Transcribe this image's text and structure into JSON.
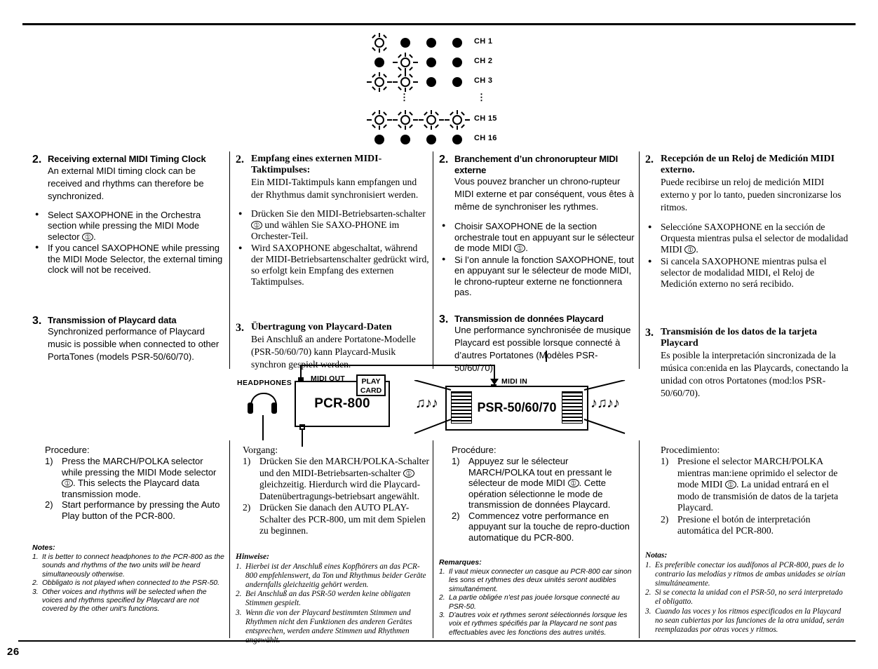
{
  "page": {
    "number": "26"
  },
  "led_matrix": {
    "rows": [
      {
        "label": "CH 1",
        "states": [
          "lit",
          "off",
          "off",
          "off"
        ]
      },
      {
        "label": "CH 2",
        "states": [
          "off",
          "lit",
          "off",
          "off"
        ]
      },
      {
        "label": "CH 3",
        "states": [
          "lit",
          "lit",
          "off",
          "off"
        ]
      },
      {
        "label": "",
        "states": [
          "gap",
          "dots",
          "gap",
          "gap"
        ],
        "is_gap": true,
        "label_dots": "⋮"
      },
      {
        "label": "CH 15",
        "states": [
          "lit",
          "lit",
          "lit",
          "lit"
        ]
      },
      {
        "label": "CH 16",
        "states": [
          "off",
          "off",
          "off",
          "off"
        ]
      }
    ]
  },
  "columns": {
    "english": {
      "section2": {
        "number": "2.",
        "heading": "Receiving external MIDI Timing Clock",
        "body": "An external MIDI timing clock can be received and rhythms can therefore be synchronized.",
        "bullets": [
          "Select SAXOPHONE in the Orchestra section while pressing the MIDI Mode selector ➀ .",
          "If you cancel SAXOPHONE while pressing the MIDI Mode Selector, the external timing clock will not be received."
        ],
        "bullet1_pre": "Select SAXOPHONE in the Orchestra section while pressing the MIDI Mode selector",
        "bullet1_post": ".",
        "bullet2": "If you cancel SAXOPHONE while pressing the MIDI Mode Selector, the external timing clock will not be received."
      },
      "section3": {
        "number": "3.",
        "heading": "Transmission of Playcard data",
        "body": "Synchronized performance of Playcard music is possible when connected to other PortaTones (models PSR-50/60/70)."
      },
      "procedure": {
        "title": "Procedure:",
        "steps": [
          {
            "n": "1)",
            "pre": "Press the MARCH/POLKA selector while pressing the MIDI Mode selector",
            "post": ". This selects the Playcard data transmission mode."
          },
          {
            "n": "2)",
            "pre": "Start performance by pressing the Auto Play button of the PCR-800.",
            "post": ""
          }
        ]
      },
      "notes": {
        "title": "Notes:",
        "items": [
          {
            "n": "1.",
            "text": "It is better to connect headphones to the PCR-800 as the sounds and rhythms of the two units will be heard simultaneously otherwise."
          },
          {
            "n": "2.",
            "text": "Obbligato is not played when connected to the PSR-50."
          },
          {
            "n": "3.",
            "text": "Other voices and rhythms will be selected when the voices and rhythms specified by Playcard are not covered by the other unit's functions."
          }
        ]
      }
    },
    "german": {
      "section2": {
        "number": "2.",
        "heading": "Empfang eines externen MIDI-Taktimpulses:",
        "body": "Ein MIDI-Taktimpuls kann empfangen und der Rhythmus damit synchronisiert werden.",
        "bullet1_pre": "Drücken Sie den MIDI-Betriebsarten-schalter",
        "bullet1_post": "und wählen Sie SAXO-PHONE im Orchester-Teil.",
        "bullet2": "Wird SAXOPHONE abgeschaltat, während der MIDI-Betriebsartenschalter gedrückt wird, so erfolgt kein Empfang des externen Taktimpulses."
      },
      "section3": {
        "number": "3.",
        "heading": "Übertragung von Playcard-Daten",
        "body": "Bei Anschluß an andere Portatone-Modelle (PSR-50/60/70) kann Playcard-Musik synchron gespielt werden."
      },
      "procedure": {
        "title": "Vorgang:",
        "steps": [
          {
            "n": "1)",
            "pre": "Drücken Sie den MARCH/POLKA-Schalter und den MIDI-Betriebsarten-schalter",
            "post": "gleichzeitig. Hierdurch wird die Playcard-Datenübertragungs-betriebsart angewählt."
          },
          {
            "n": "2)",
            "pre": "Drücken Sie danach den AUTO PLAY-Schalter des PCR-800, um mit dem Spielen zu beginnen.",
            "post": ""
          }
        ]
      },
      "notes": {
        "title": "Hinweise:",
        "items": [
          {
            "n": "1.",
            "text": "Hierbei ist der Anschluß eines Kopfhörers an das PCR-800 empfehlenswert, da Ton und Rhythmus beider Geräte andernfalls gleichzeitig gehört werden."
          },
          {
            "n": "2.",
            "text": "Bei Anschluß an das PSR-50 werden keine obligaten Stimmen gespielt."
          },
          {
            "n": "3.",
            "text": "Wenn die von der Playcard bestimmten Stimmen und Rhythmen nicht den Funktionen des anderen Gerätes entsprechen, werden andere Stimmen und Rhythmen angewählt."
          }
        ]
      }
    },
    "french": {
      "section2": {
        "number": "2.",
        "heading": "Branchement d’un chronorupteur MIDI externe",
        "body": "Vous pouvez brancher un chrono-rupteur MIDI externe et par conséquent, vous êtes à même de synchroniser les rythmes.",
        "bullet1_pre": "Choisir SAXOPHONE de la section orchestrale tout en appuyant sur le sélecteur de mode MIDI",
        "bullet1_post": ".",
        "bullet2": "Si l’on annule la fonction SAXOPHONE, tout en appuyant sur le sélecteur de mode MIDI, le chrono-rupteur externe ne fonctionnera pas."
      },
      "section3": {
        "number": "3.",
        "heading": "Transmission de données Playcard",
        "body": "Une performance synchronisée de musique Playcard est possible lorsque connecté à d’autres Portatones (Modèles PSR-50/60/70)."
      },
      "procedure": {
        "title": "Procédure:",
        "steps": [
          {
            "n": "1)",
            "pre": "Appuyez sur le sélecteur MARCH/POLKA tout en pressant le sélecteur de mode MIDI",
            "post": ". Cette opération sélectionne le mode de transmission de données Playcard."
          },
          {
            "n": "2)",
            "pre": "Commencez votre performance en appuyant sur la touche de repro-duction automatique du PCR-800.",
            "post": ""
          }
        ]
      },
      "notes": {
        "title": "Remarques:",
        "items": [
          {
            "n": "1.",
            "text": "Il vaut mieux connecter un casque au PCR-800 car sinon les sons et rythmes des deux uinités seront audibles simultanément."
          },
          {
            "n": "2.",
            "text": "La partie obligée n'est pas jouée lorsque connecté au PSR-50."
          },
          {
            "n": "3.",
            "text": "D'autres voix et rythmes seront sélectionnés lorsque les voix et rythmes spécifiés par la Playcard ne sont pas effectuables avec les fonctions des autres unités."
          }
        ]
      }
    },
    "spanish": {
      "section2": {
        "number": "2.",
        "heading": "Recepción de un Reloj de Medición MIDI externo.",
        "body": "Puede recibirse un reloj de medición MIDI externo y por lo tanto, pueden sincronizarse los ritmos.",
        "bullet1_pre": "Seleccióne SAXOPHONE en la sección de Orquesta mientras pulsa el selector de modalidad MIDI",
        "bullet1_post": ".",
        "bullet2": "Si cancela SAXOPHONE mientras pulsa el selector de modalidad MIDI, el Reloj de Medición externo no será recibido."
      },
      "section3": {
        "number": "3.",
        "heading": "Transmisión de los datos de la tarjeta Playcard",
        "body": "Es posible la interpretación sincronizada de la música con:enida en las Playcards, conectando la unidad con otros Portatones (mod:los PSR-50/60/70)."
      },
      "procedure": {
        "title": "Procedimiento:",
        "steps": [
          {
            "n": "1)",
            "pre": "Presione el selector MARCH/POLKA mientras man:iene oprimido el selector de mode MIDI",
            "post": ". La unidad entrará en el modo de transmisión de datos de la tarjeta Playcard."
          },
          {
            "n": "2)",
            "pre": "Presione el botón de interpretación automática del PCR-800.",
            "post": ""
          }
        ]
      },
      "notes": {
        "title": "Notas:",
        "items": [
          {
            "n": "1.",
            "text": "Es preferible conectar ios audífonos al PCR-800, pues de lo contrario las melodías y ritmos de ambas unidades se oirían simultáneamente."
          },
          {
            "n": "2.",
            "text": "Si se conecta la unidad con el PSR-50, no será interpretado el obligatto."
          },
          {
            "n": "3.",
            "text": "Cuando las voces y los ritmos especificados en la Playcard no sean cubiertas por las funciones de la otra unidad, serán reemplazadas por otras voces y ritmos."
          }
        ]
      }
    }
  },
  "diagram": {
    "headphones_label": "HEADPHONES",
    "midi_out_label": "MIDI OUT",
    "midi_in_label": "MIDI IN",
    "playcard_label_line1": "PLAY",
    "playcard_label_line2": "CARD",
    "pcr_name": "PCR-800",
    "psr_name": "PSR-50/60/70",
    "notes_left": "♫♪♪",
    "notes_right": "♪♫♪♪"
  },
  "callout_marker": "➀"
}
